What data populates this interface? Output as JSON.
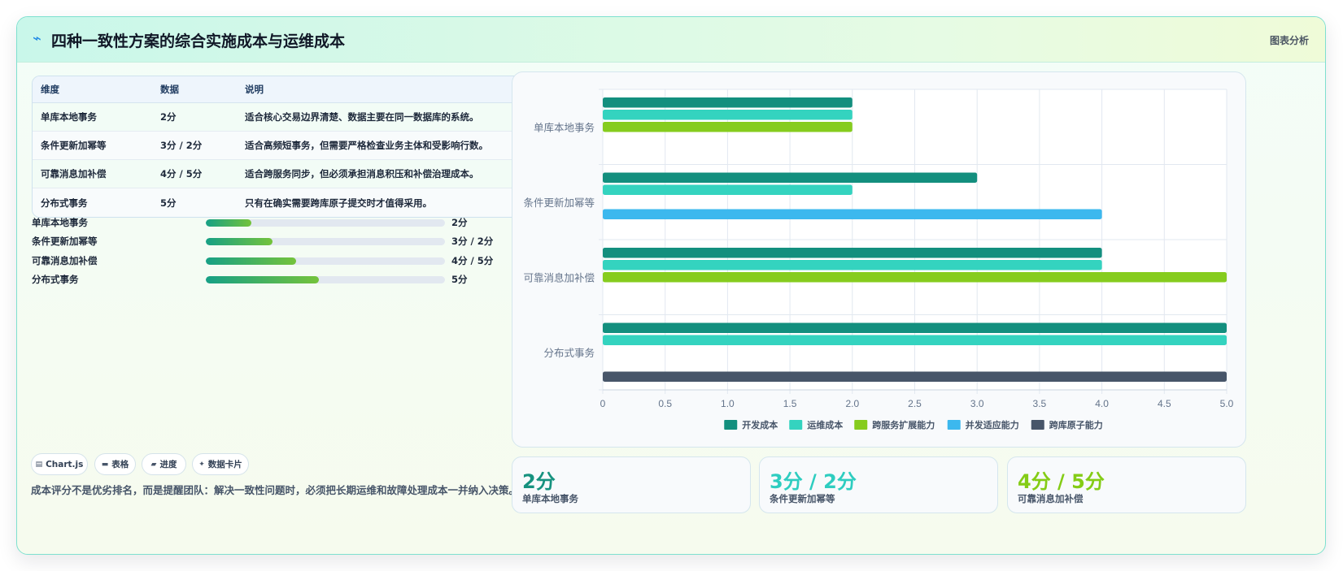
{
  "header": {
    "title": "四种一致性方案的综合实施成本与运维成本",
    "link": "图表分析",
    "icon": "lightning-icon"
  },
  "table": {
    "headers": [
      "维度",
      "数据",
      "说明"
    ],
    "rows": [
      {
        "dim": "单库本地事务",
        "val": "2分",
        "desc": "适合核心交易边界清楚、数据主要在同一数据库的系统。"
      },
      {
        "dim": "条件更新加幂等",
        "val": "3分 / 2分",
        "desc": "适合高频短事务，但需要严格检查业务主体和受影响行数。"
      },
      {
        "dim": "可靠消息加补偿",
        "val": "4分 / 5分",
        "desc": "适合跨服务同步，但必须承担消息积压和补偿治理成本。"
      },
      {
        "dim": "分布式事务",
        "val": "5分",
        "desc": "只有在确实需要跨库原子提交时才值得采用。"
      }
    ]
  },
  "progress": [
    {
      "label": "单库本地事务",
      "value": "2分",
      "fraction": 0.19
    },
    {
      "label": "条件更新加幂等",
      "value": "3分 / 2分",
      "fraction": 0.28
    },
    {
      "label": "可靠消息加补偿",
      "value": "4分 / 5分",
      "fraction": 0.377
    },
    {
      "label": "分布式事务",
      "value": "5分",
      "fraction": 0.472
    }
  ],
  "chips": [
    {
      "label": "Chart.js",
      "icon": "chart-icon"
    },
    {
      "label": "表格",
      "icon": "table-icon"
    },
    {
      "label": "进度",
      "icon": "progress-icon"
    },
    {
      "label": "数据卡片",
      "icon": "sparkle-icon"
    }
  ],
  "footnote": "成本评分不是优劣排名，而是提醒团队：解决一致性问题时，必须把长期运维和故障处理成本一并纳入决策。",
  "stats": [
    {
      "value": "2分",
      "label": "单库本地事务",
      "color": "#16927f"
    },
    {
      "value": "3分 / 2分",
      "label": "条件更新加幂等",
      "color": "#2ecdc0"
    },
    {
      "value": "4分 / 5分",
      "label": "可靠消息加补偿",
      "color": "#84cc16"
    }
  ],
  "chart_data": {
    "type": "bar",
    "orientation": "horizontal",
    "categories": [
      "单库本地事务",
      "条件更新加幂等",
      "可靠消息加补偿",
      "分布式事务"
    ],
    "series": [
      {
        "name": "开发成本",
        "color": "#138f7e",
        "values": [
          2,
          3,
          4,
          5
        ]
      },
      {
        "name": "运维成本",
        "color": "#34d3bf",
        "values": [
          2,
          2,
          4,
          5
        ]
      },
      {
        "name": "跨服务扩展能力",
        "color": "#86cc1e",
        "values": [
          2,
          null,
          5,
          null
        ]
      },
      {
        "name": "并发适应能力",
        "color": "#3cb8ee",
        "values": [
          null,
          4,
          null,
          null
        ]
      },
      {
        "name": "跨库原子能力",
        "color": "#475569",
        "values": [
          null,
          null,
          null,
          5
        ]
      }
    ],
    "xlim": [
      0,
      5
    ],
    "xticks": [
      "0",
      "0.5",
      "1.0",
      "1.5",
      "2.0",
      "2.5",
      "3.0",
      "3.5",
      "4.0",
      "4.5",
      "5.0"
    ],
    "grid": true,
    "legend": "bottom"
  }
}
